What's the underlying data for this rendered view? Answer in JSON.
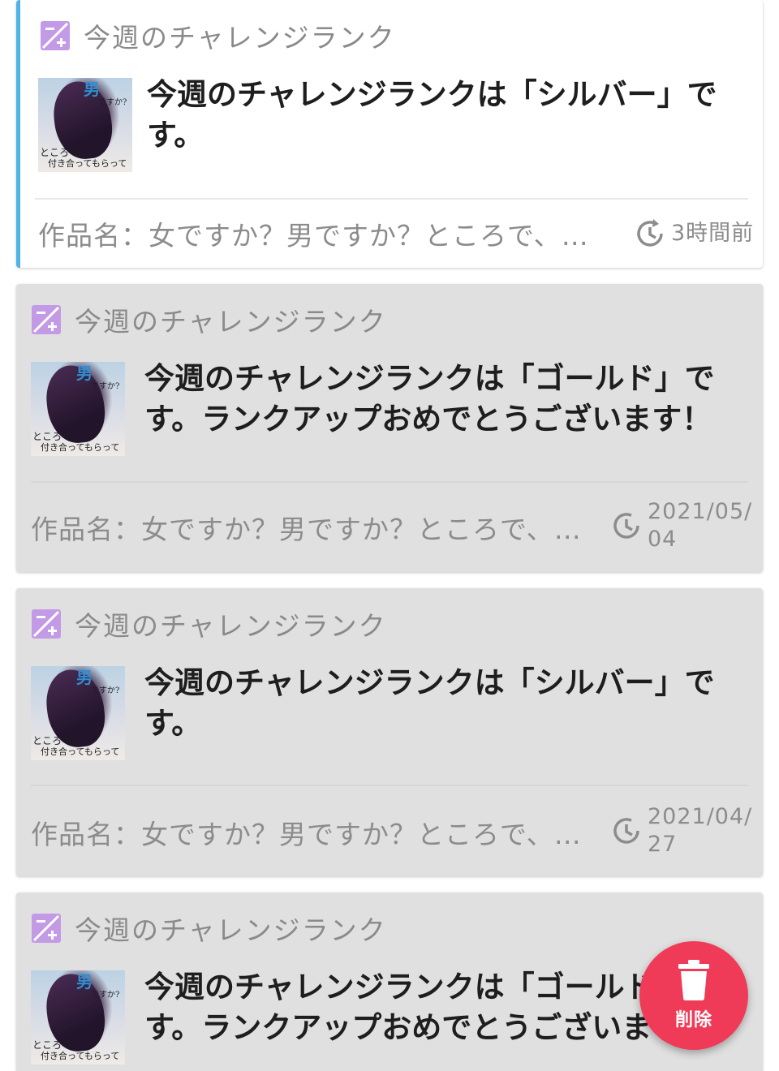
{
  "colors": {
    "unread_accent": "#4fb3e8",
    "category_icon": "#c39ae6",
    "delete_button": "#ef3b57",
    "card_read_bg": "#e0e0e0",
    "card_unread_bg": "#ffffff"
  },
  "notifications": [
    {
      "category_icon": "edit-plus-icon",
      "category": "今週のチャレンジランク",
      "title": "今週のチャレンジランクは「シルバー」です。",
      "work_name": "作品名：女ですか？男ですか？ところで、付…",
      "time_icon": "clock-arrow-icon",
      "time": "3時間前",
      "unread": true
    },
    {
      "category_icon": "edit-plus-icon",
      "category": "今週のチャレンジランク",
      "title": "今週のチャレンジランクは「ゴールド」です。ランクアップおめでとうございます！",
      "work_name": "作品名：女ですか？男ですか？ところで、付…",
      "time_icon": "clock-icon",
      "time": "2021/05/\n04",
      "unread": false
    },
    {
      "category_icon": "edit-plus-icon",
      "category": "今週のチャレンジランク",
      "title": "今週のチャレンジランクは「シルバー」です。",
      "work_name": "作品名：女ですか？男ですか？ところで、付…",
      "time_icon": "clock-icon",
      "time": "2021/04/\n27",
      "unread": false
    },
    {
      "category_icon": "edit-plus-icon",
      "category": "今週のチャレンジランク",
      "title": "今週のチャレンジランクは「ゴールド」です。ランクアップおめでとうございます！",
      "unread": false
    }
  ],
  "thumbnail": {
    "text_top": "男",
    "text_question": "ですか?",
    "text_bottom_1": "ところで、",
    "text_bottom_2": "付き合ってもらって"
  },
  "delete_button": {
    "icon": "trash-icon",
    "label": "削除"
  }
}
